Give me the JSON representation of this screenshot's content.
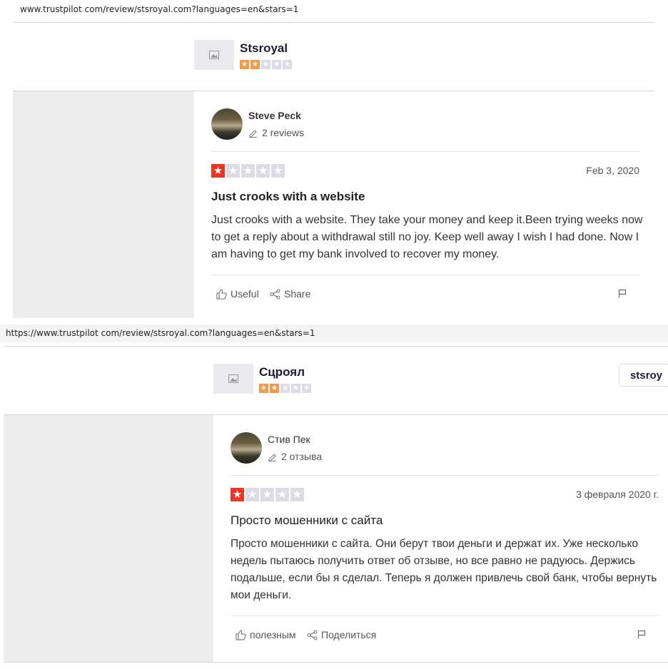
{
  "top": {
    "url": "www.trustpilot com/review/stsroyal.com?languages=en&stars=1",
    "company": {
      "name": "Stsroyal",
      "rating_stars": 2,
      "star_color": "#f2994a"
    },
    "review": {
      "author": "Steve Peck",
      "reviews_count": "2 reviews",
      "rating_stars": 1,
      "date": "Feb 3, 2020",
      "title": "Just crooks with a website",
      "body": "Just crooks with a website. They take your money and keep it.Been trying weeks now to get a reply about a withdrawal still no joy. Keep well away I wish I had done. Now I am having to get my bank involved to recover my money.",
      "useful": "Useful",
      "share": "Share"
    }
  },
  "bottom": {
    "url": "https://www.trustpilot com/review/stsroyal.com?languages=en&stars=1",
    "company": {
      "name": "Сцроял",
      "rating_stars": 2,
      "star_color": "#f2994a"
    },
    "visit_button": "stsroy",
    "review": {
      "author": "Стив Пек",
      "reviews_count": "2 отзыва",
      "rating_stars": 1,
      "date": "3 февраля 2020 г.",
      "title": "Просто мошенники с сайта",
      "body": "Просто мошенники с сайта. Они берут твои деньги и держат их. Уже несколько недель пытаюсь получить ответ об отзыве, но все равно не радуюсь. Держись подальше, если бы я сделал. Теперь я должен привлечь свой банк, чтобы вернуть мои деньги.",
      "useful": "полезным",
      "share": "Поделиться"
    }
  },
  "colors": {
    "red_star": "#ee3423",
    "orange_star": "#f2994a",
    "empty_star": "#dcdce6"
  },
  "icons": [
    "image-placeholder-icon",
    "star-icon",
    "pencil-icon",
    "thumbs-up-icon",
    "share-icon",
    "flag-icon",
    "external-link-icon"
  ]
}
